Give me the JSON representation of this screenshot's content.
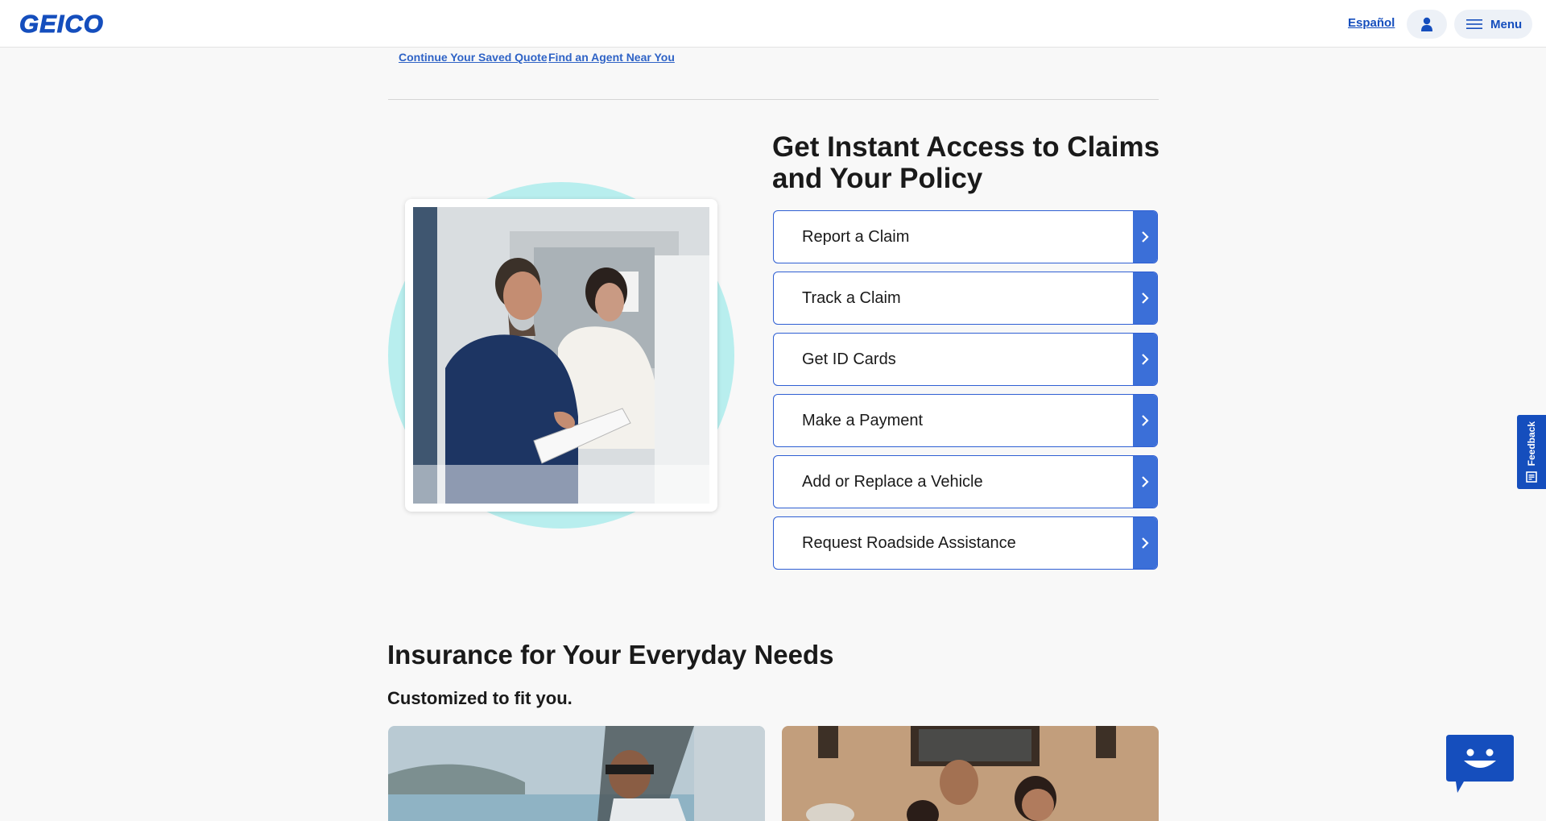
{
  "header": {
    "logo_text": "GEICO",
    "espanol_label": "Español",
    "account_icon": "user-icon",
    "menu_label": "Menu",
    "menu_icon": "hamburger-icon"
  },
  "quick_links": {
    "saved_quote": "Continue Your Saved Quote",
    "find_agent": "Find an Agent Near You"
  },
  "access": {
    "title": "Get Instant Access to Claims and Your Policy",
    "actions": [
      {
        "label": "Report a Claim"
      },
      {
        "label": "Track a Claim"
      },
      {
        "label": "Get ID Cards"
      },
      {
        "label": "Make a Payment"
      },
      {
        "label": "Add or Replace a Vehicle"
      },
      {
        "label": "Request Roadside Assistance"
      }
    ]
  },
  "needs": {
    "title": "Insurance for Your Everyday Needs",
    "subtitle": "Customized to fit you."
  },
  "feedback": {
    "label": "Feedback",
    "icon": "feedback-icon"
  },
  "chat": {
    "icon": "chatbot-icon"
  },
  "colors": {
    "brand_blue": "#154ebd",
    "action_arrow": "#3b6fd8",
    "circle_teal": "#b8eeee",
    "background": "#f8f8f8"
  }
}
